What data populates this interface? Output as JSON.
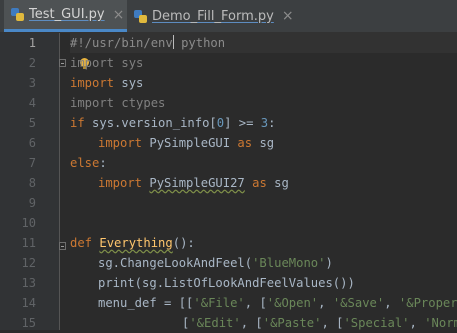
{
  "tabs": [
    {
      "label": "Test_GUI.py",
      "close": "×",
      "active": true
    },
    {
      "label": "Demo_Fill_Form.py",
      "close": "×",
      "active": false
    }
  ],
  "editor": {
    "current_line": 1,
    "line_numbers": [
      "1",
      "2",
      "3",
      "4",
      "5",
      "6",
      "7",
      "8",
      "9",
      "10",
      "11",
      "12",
      "13",
      "14",
      "15"
    ],
    "lines": {
      "l1": {
        "shebang_a": "#!/usr/bin/env",
        "shebang_b": " python"
      },
      "l2": {
        "kw": "import",
        "mod": " sys"
      },
      "l3": {
        "kw": "import",
        "mod": " sys"
      },
      "l4": {
        "kw": "import",
        "mod": " ctypes"
      },
      "l5": {
        "kw": "if",
        "a": " sys.version_info[",
        "n0": "0",
        "b": "] >= ",
        "n3": "3",
        "c": ":"
      },
      "l6": {
        "kw": "import",
        "mod": " PySimpleGUI ",
        "as": "as",
        "alias": " sg"
      },
      "l7": {
        "kw": "else",
        "c": ":"
      },
      "l8": {
        "kw": "import",
        "sp": " ",
        "mod": "PySimpleGUI27",
        "as": " as",
        "alias": " sg"
      },
      "l11": {
        "kw": "def",
        "sp": " ",
        "fn": "Everything",
        "rest": "():"
      },
      "l12": {
        "a": "sg.ChangeLookAndFeel(",
        "s": "'BlueMono'",
        "b": ")"
      },
      "l13": {
        "a": "print(sg.ListOfLookAndFeelValues())"
      },
      "l14": {
        "a": "menu_def = [[",
        "s1": "'&File'",
        "c1": ", [",
        "s2": "'&Open'",
        "c2": ", ",
        "s3": "'&Save'",
        "c3": ", ",
        "s4": "'&Propertie"
      },
      "l15": {
        "a": "[",
        "s1": "'&Edit'",
        "c1": ", [",
        "s2": "'&Paste'",
        "c2": ", [",
        "s3": "'Special'",
        "c3": ", ",
        "s4": "'Norma"
      }
    }
  },
  "colors": {
    "background": "#2b2b2b",
    "keyword": "#cc7832",
    "string": "#6a8759",
    "number": "#6897bb",
    "comment": "#808080",
    "function": "#ffc66d",
    "text": "#a9b7c6"
  },
  "icons": [
    "python-file-icon",
    "close-icon",
    "fold-icon",
    "intention-bulb-icon"
  ]
}
